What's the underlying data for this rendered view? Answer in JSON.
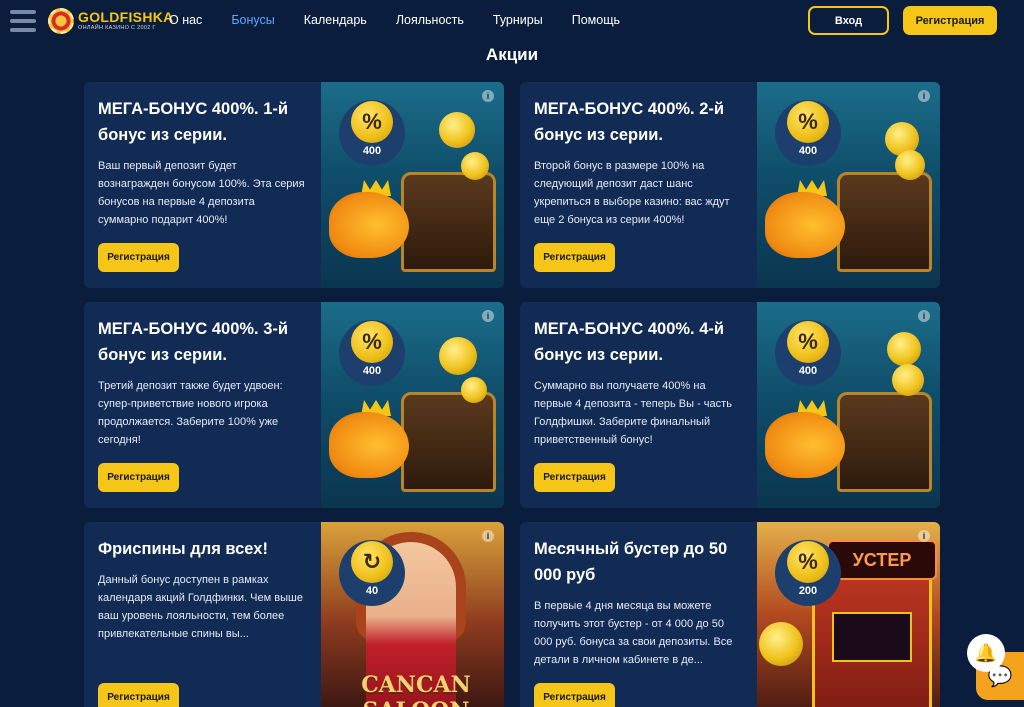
{
  "header": {
    "logo": {
      "name": "GOLDFISHKA",
      "subtitle": "ОНЛАЙН КАЗИНО С 2002 Г"
    },
    "nav": [
      {
        "label": "О нас",
        "active": false
      },
      {
        "label": "Бонусы",
        "active": true
      },
      {
        "label": "Календарь",
        "active": false
      },
      {
        "label": "Лояльность",
        "active": false
      },
      {
        "label": "Турниры",
        "active": false
      },
      {
        "label": "Помощь",
        "active": false
      }
    ],
    "login_label": "Вход",
    "register_label": "Регистрация"
  },
  "page": {
    "title": "Акции"
  },
  "cards": [
    {
      "title": "МЕГА-БОНУС 400%. 1-й бонус из серии.",
      "description": "Ваш первый депозит будет вознагражден бонусом 100%. Эта серия бонусов на первые 4 депозита суммарно подарит 400%!",
      "button": "Регистрация",
      "badge_icon": "%",
      "badge_value": "400",
      "info": "i"
    },
    {
      "title": "МЕГА-БОНУС 400%. 2-й бонус из серии.",
      "description": "Второй бонус в размере 100% на следующий депозит даст шанс укрепиться в выборе казино: вас ждут еще 2 бонуса из серии 400%!",
      "button": "Регистрация",
      "badge_icon": "%",
      "badge_value": "400",
      "info": "i"
    },
    {
      "title": "МЕГА-БОНУС 400%. 3-й бонус из серии.",
      "description": "Третий депозит также будет удвоен: супер-приветствие нового игрока продолжается. Заберите 100% уже сегодня!",
      "button": "Регистрация",
      "badge_icon": "%",
      "badge_value": "400",
      "info": "i"
    },
    {
      "title": "МЕГА-БОНУС 400%. 4-й бонус из серии.",
      "description": "Суммарно вы получаете 400% на первые 4 депозита - теперь Вы - часть Голдфишки. Заберите финальный приветственный бонус!",
      "button": "Регистрация",
      "badge_icon": "%",
      "badge_value": "400",
      "info": "i"
    },
    {
      "title": "Фриспины для всех!",
      "description": "Данный бонус доступен в рамках календаря акций Голдфинки. Чем выше ваш уровень лояльности, тем более привлекательные спины вы...",
      "button": "Регистрация",
      "badge_icon": "↻",
      "badge_value": "40",
      "info": "i",
      "art_text": "CANCAN SALOON"
    },
    {
      "title": "Месячный бустер до 50 000 руб",
      "description": "В первые 4 дня месяца вы можете получить этот бустер - от 4 000 до 50 000 руб. бонуса за свои депозиты. Все детали в личном кабинете в де...",
      "button": "Регистрация",
      "badge_icon": "%",
      "badge_value": "200",
      "info": "i",
      "art_text": "УСТЕР"
    }
  ],
  "floating": {
    "bell_icon": "🔔",
    "chat_icon": "💬"
  },
  "colors": {
    "background": "#0b1d3d",
    "card": "#122b54",
    "accent": "#f5c518",
    "active_nav": "#5aa9ff"
  }
}
